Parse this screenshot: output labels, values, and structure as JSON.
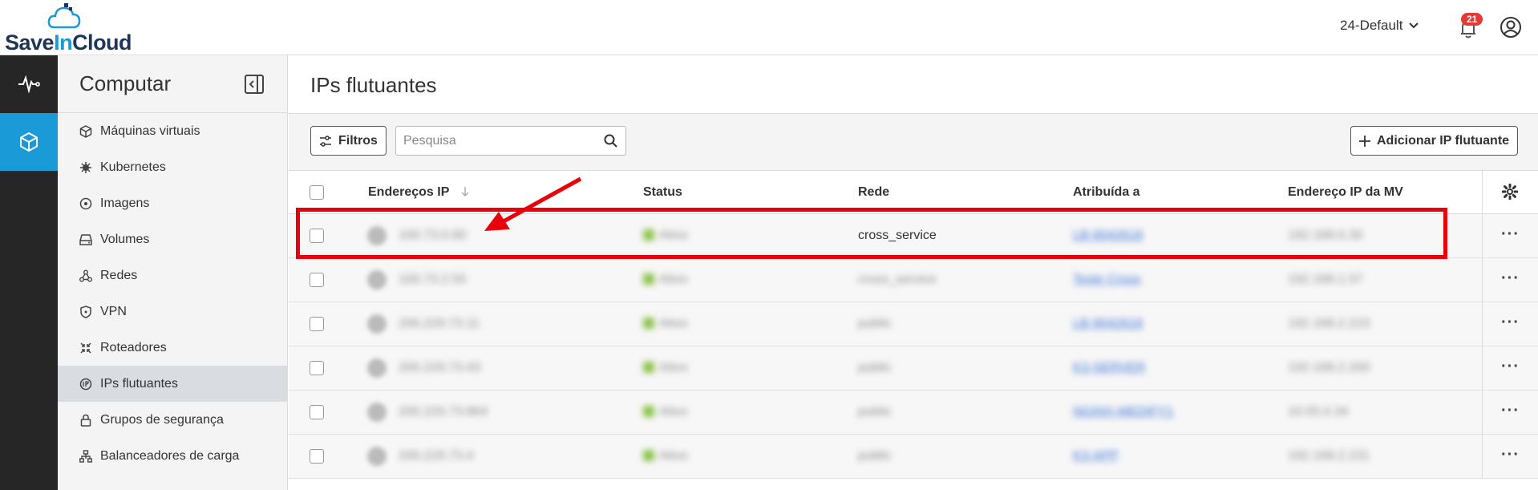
{
  "brand": {
    "logo_text_1": "Save",
    "logo_text_2": "In",
    "logo_text_3": "Cloud"
  },
  "header": {
    "project": "24-Default",
    "notifications_count": "21"
  },
  "sidenav": {
    "title": "Computar",
    "items": [
      {
        "label": "Máquinas virtuais",
        "icon": "cube-icon"
      },
      {
        "label": "Kubernetes",
        "icon": "helm-icon"
      },
      {
        "label": "Imagens",
        "icon": "disc-icon"
      },
      {
        "label": "Volumes",
        "icon": "drive-icon"
      },
      {
        "label": "Redes",
        "icon": "network-icon"
      },
      {
        "label": "VPN",
        "icon": "shield-icon"
      },
      {
        "label": "Roteadores",
        "icon": "router-icon"
      },
      {
        "label": "IPs flutuantes",
        "icon": "floating-ip-icon",
        "active": true
      },
      {
        "label": "Grupos de segurança",
        "icon": "lock-icon"
      },
      {
        "label": "Balanceadores de carga",
        "icon": "load-balancer-icon"
      }
    ]
  },
  "main": {
    "title": "IPs flutuantes",
    "filters_label": "Filtros",
    "search_placeholder": "Pesquisa",
    "add_label": "Adicionar IP flutuante"
  },
  "table": {
    "columns": [
      "Endereços IP",
      "Status",
      "Rede",
      "Atribuída a",
      "Endereço IP da MV"
    ],
    "rows": [
      {
        "ip": "100.73.0.80",
        "status": "Ativo",
        "network": "cross_service",
        "network_blurred": false,
        "assigned": "LB-9042618",
        "vm_ip": "192.168.0.30"
      },
      {
        "ip": "100.73.2.55",
        "status": "Ativo",
        "network": "cross_service",
        "network_blurred": true,
        "assigned": "Teste Cross",
        "vm_ip": "192.168.1.57"
      },
      {
        "ip": "200.229.73.11",
        "status": "Ativo",
        "network": "public",
        "network_blurred": true,
        "assigned": "LB-9042618",
        "vm_ip": "192.168.2.223"
      },
      {
        "ip": "200.229.73.43",
        "status": "Ativo",
        "network": "public",
        "network_blurred": true,
        "assigned": "K3-SERVER",
        "vm_ip": "192.168.2.200"
      },
      {
        "ip": "200.229.73.864",
        "status": "Ativo",
        "network": "public",
        "network_blurred": true,
        "assigned": "NGINX-MEDIFY1",
        "vm_ip": "10.55.0.34"
      },
      {
        "ip": "200.229.73.4",
        "status": "Ativo",
        "network": "public",
        "network_blurred": true,
        "assigned": "K3-APP",
        "vm_ip": "192.168.2.231"
      }
    ]
  },
  "colors": {
    "accent": "#1a9ad6",
    "annotation": "#e8000b",
    "rail": "#262626"
  }
}
